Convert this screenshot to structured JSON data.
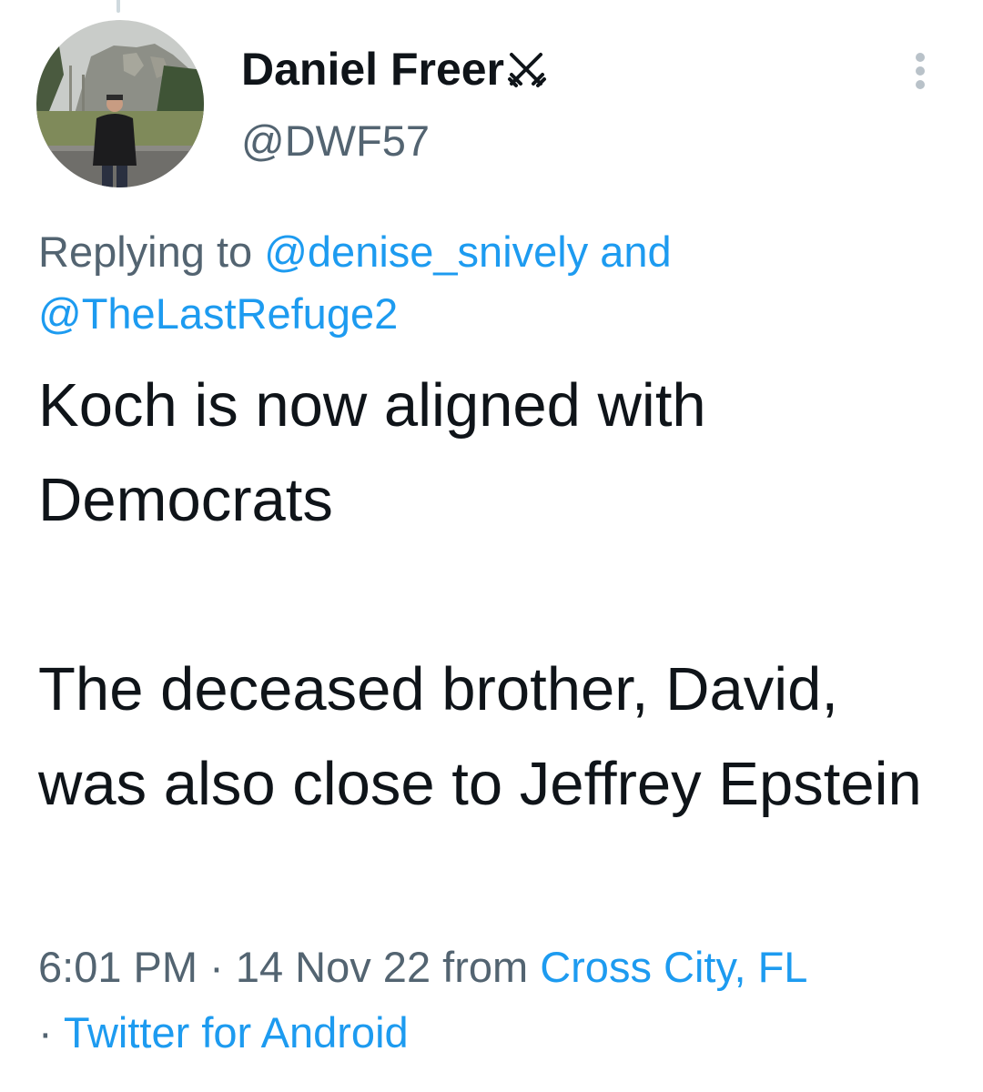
{
  "author": {
    "display_name": "Daniel Freer",
    "badge_icon": "crossed-swords-icon",
    "handle": "@DWF57",
    "avatar_icon": "profile-photo"
  },
  "menu": {
    "icon": "more-vertical-icon"
  },
  "reply": {
    "prefix": "Replying to",
    "user1": "@denise_snively",
    "conjunction": "and",
    "user2": "@TheLastRefuge2"
  },
  "tweet": {
    "paragraph1": "Koch is now aligned with Democrats",
    "paragraph2": "The deceased brother, David, was also close to Jeffrey Epstein"
  },
  "meta": {
    "time": "6:01 PM",
    "separator": "·",
    "date": "14 Nov 22",
    "from_label": "from",
    "location": "Cross City, FL",
    "client": "Twitter for Android"
  },
  "colors": {
    "text": "#0f1419",
    "secondary": "#536471",
    "link": "#1d9bf0"
  }
}
